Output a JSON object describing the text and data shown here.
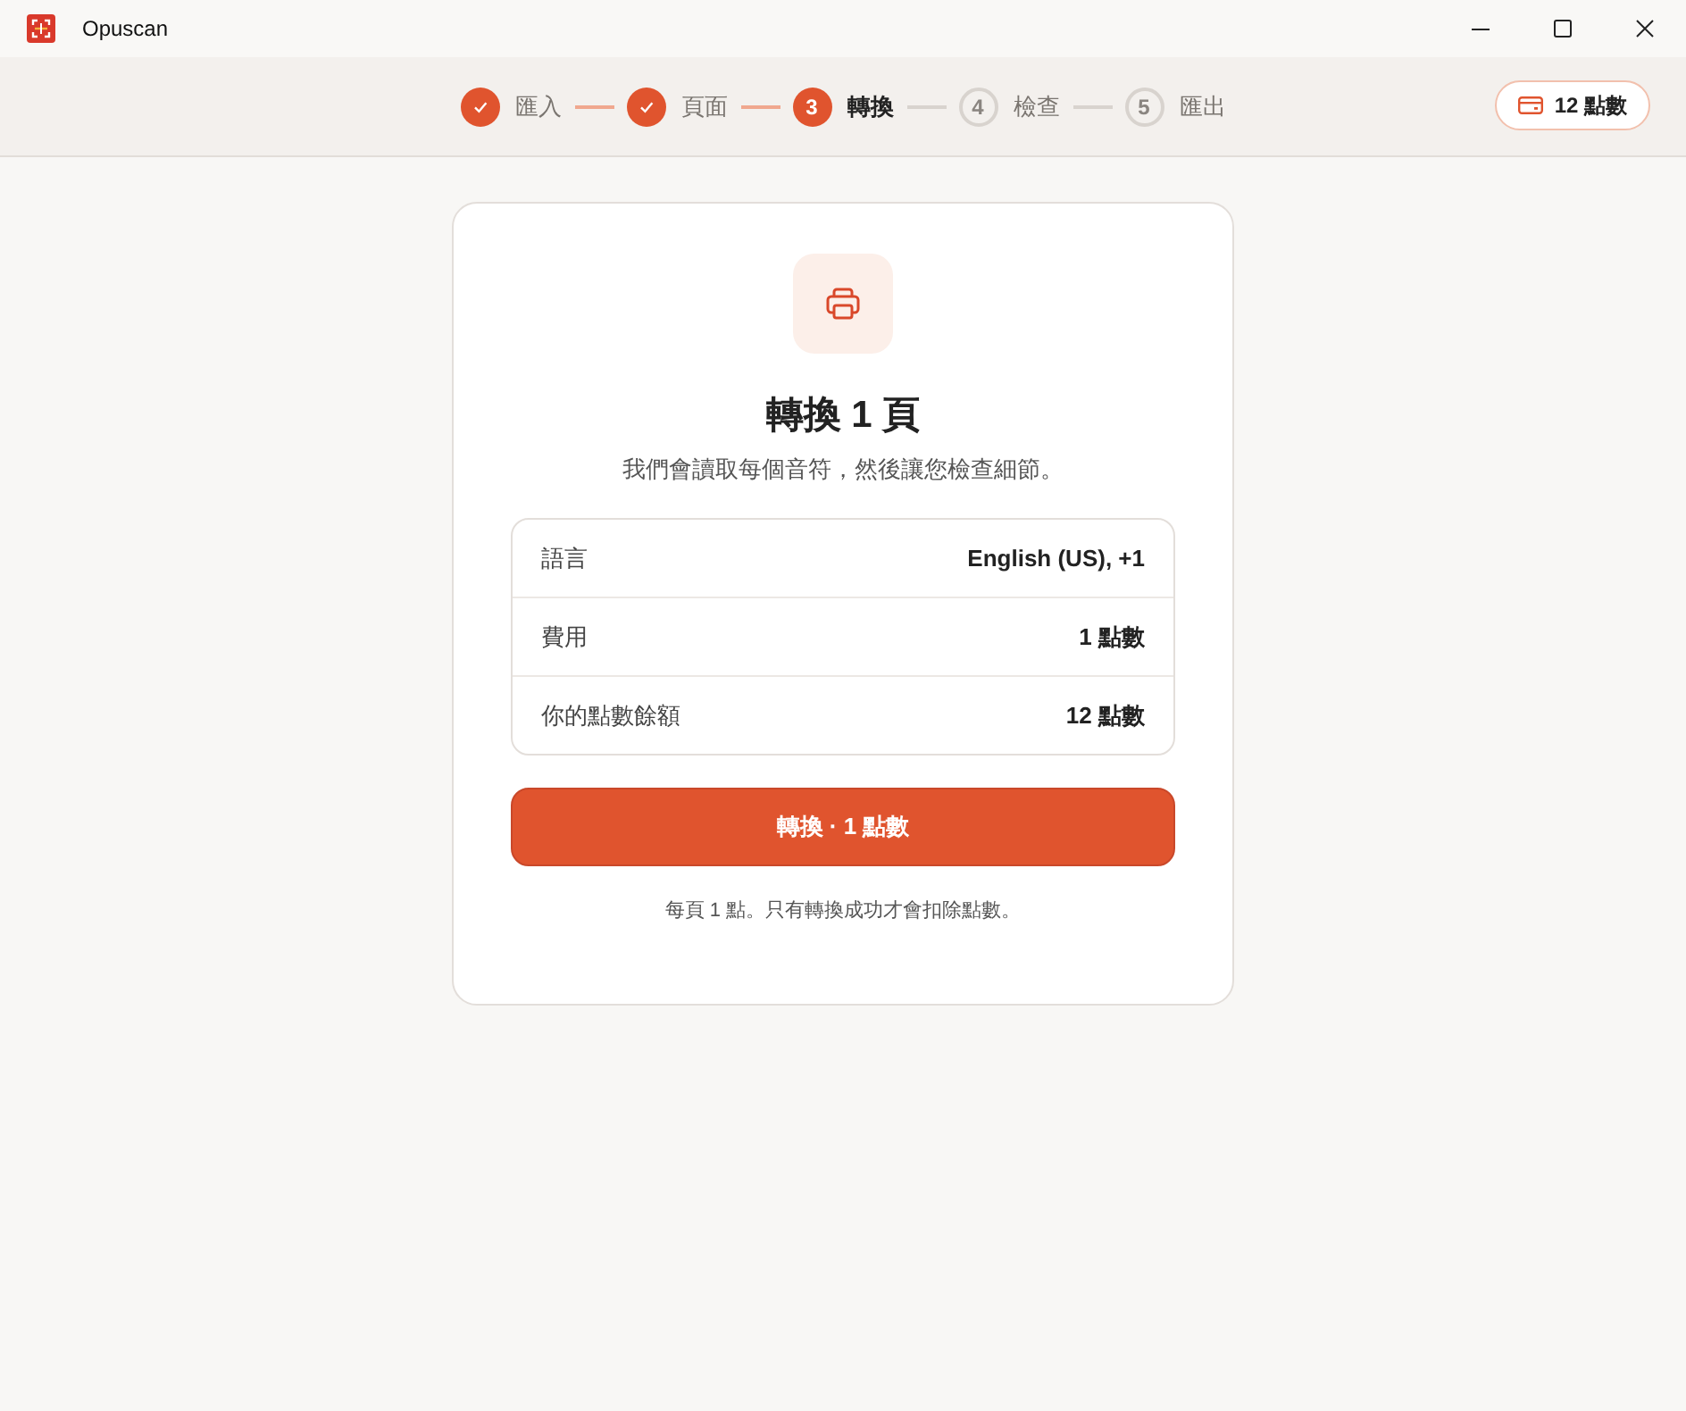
{
  "window": {
    "title": "Opuscan"
  },
  "stepper": {
    "steps": [
      {
        "label": "匯入",
        "done": true,
        "selected": false
      },
      {
        "label": "頁面",
        "done": true,
        "selected": false
      },
      {
        "number": "3",
        "label": "轉換",
        "done": false,
        "selected": true
      },
      {
        "number": "4",
        "label": "檢查",
        "done": false,
        "selected": false
      },
      {
        "number": "5",
        "label": "匯出",
        "done": false,
        "selected": false
      }
    ]
  },
  "credits_badge": {
    "label": "12 點數"
  },
  "card": {
    "title": "轉換 1 頁",
    "subtitle": "我們會讀取每個音符，然後讓您檢查細節。",
    "details": [
      {
        "label": "語言",
        "value": "English (US), +1"
      },
      {
        "label": "費用",
        "value": "1 點數"
      },
      {
        "label": "你的點數餘額",
        "value": "12 點數"
      }
    ],
    "primary_button": "轉換 · 1 點數",
    "note": "每頁 1 點。只有轉換成功才會扣除點數。"
  }
}
